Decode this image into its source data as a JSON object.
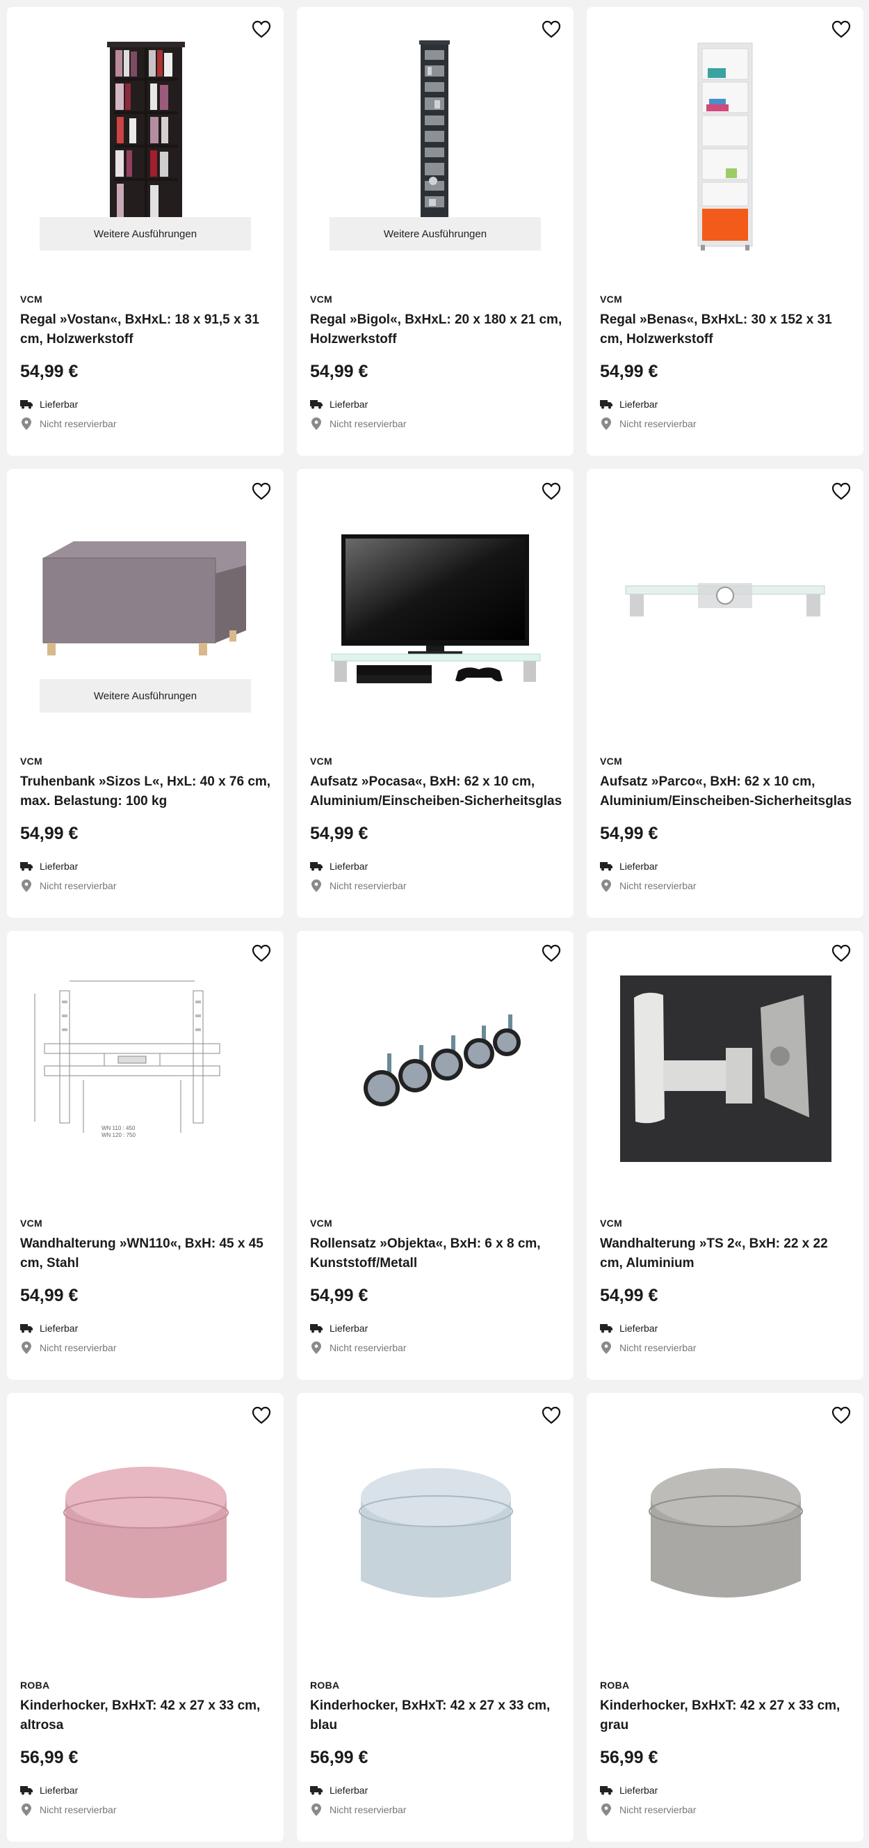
{
  "common": {
    "delivery_label": "Lieferbar",
    "reserve_label": "Nicht reservierbar",
    "more_label": "Weitere Ausführungen"
  },
  "colors": {
    "text": "#1a1a1a",
    "muted": "#777777",
    "button_bg": "#efefef",
    "page_bg": "#f2f2f2"
  },
  "products": [
    {
      "brand": "VCM",
      "title": "Regal »Vostan«, BxHxL: 18 x 91,5 x 31 cm, Holzwerkstoff",
      "price": "54,99 €",
      "image": "dark-cd-shelf"
    },
    {
      "brand": "VCM",
      "title": "Regal »Bigol«, BxHxL: 20 x 180 x 21 cm, Holzwerkstoff",
      "price": "54,99 €",
      "image": "tall-slim-shelf"
    },
    {
      "brand": "VCM",
      "title": "Regal »Benas«, BxHxL: 30 x 152 x 31 cm, Holzwerkstoff",
      "price": "54,99 €",
      "image": "white-shelf-orange-box"
    },
    {
      "brand": "VCM",
      "title": "Truhenbank »Sizos L«, HxL: 40 x 76 cm, max. Belastung: 100 kg",
      "price": "54,99 €",
      "image": "grey-storage-bench"
    },
    {
      "brand": "VCM",
      "title": "Aufsatz »Pocasa«, BxH: 62 x 10 cm, Aluminium/Einscheiben-Sicherheitsglas",
      "price": "54,99 €",
      "image": "tv-on-glass-stand"
    },
    {
      "brand": "VCM",
      "title": "Aufsatz »Parco«, BxH: 62 x 10 cm, Aluminium/Einscheiben-Sicherheitsglas",
      "price": "54,99 €",
      "image": "glass-riser"
    },
    {
      "brand": "VCM",
      "title": "Wandhalterung »WN110«, BxH: 45 x 45 cm, Stahl",
      "price": "54,99 €",
      "image": "wall-mount-drawing"
    },
    {
      "brand": "VCM",
      "title": "Rollensatz »Objekta«, BxH: 6 x 8 cm, Kunststoff/Metall",
      "price": "54,99 €",
      "image": "caster-set"
    },
    {
      "brand": "VCM",
      "title": "Wandhalterung »TS 2«, BxH: 22 x 22 cm, Aluminium",
      "price": "54,99 €",
      "image": "swivel-wall-mount"
    },
    {
      "brand": "ROBA",
      "title": "Kinderhocker, BxHxT: 42 x 27 x 33 cm, altrosa",
      "price": "56,99 €",
      "image": "pouf-pink"
    },
    {
      "brand": "ROBA",
      "title": "Kinderhocker, BxHxT: 42 x 27 x 33 cm, blau",
      "price": "56,99 €",
      "image": "pouf-blue"
    },
    {
      "brand": "ROBA",
      "title": "Kinderhocker, BxHxT: 42 x 27 x 33 cm, grau",
      "price": "56,99 €",
      "image": "pouf-grey"
    }
  ],
  "wall_mount_labels": {
    "a": "WN 110 : 450",
    "b": "WN 120 : 750"
  }
}
